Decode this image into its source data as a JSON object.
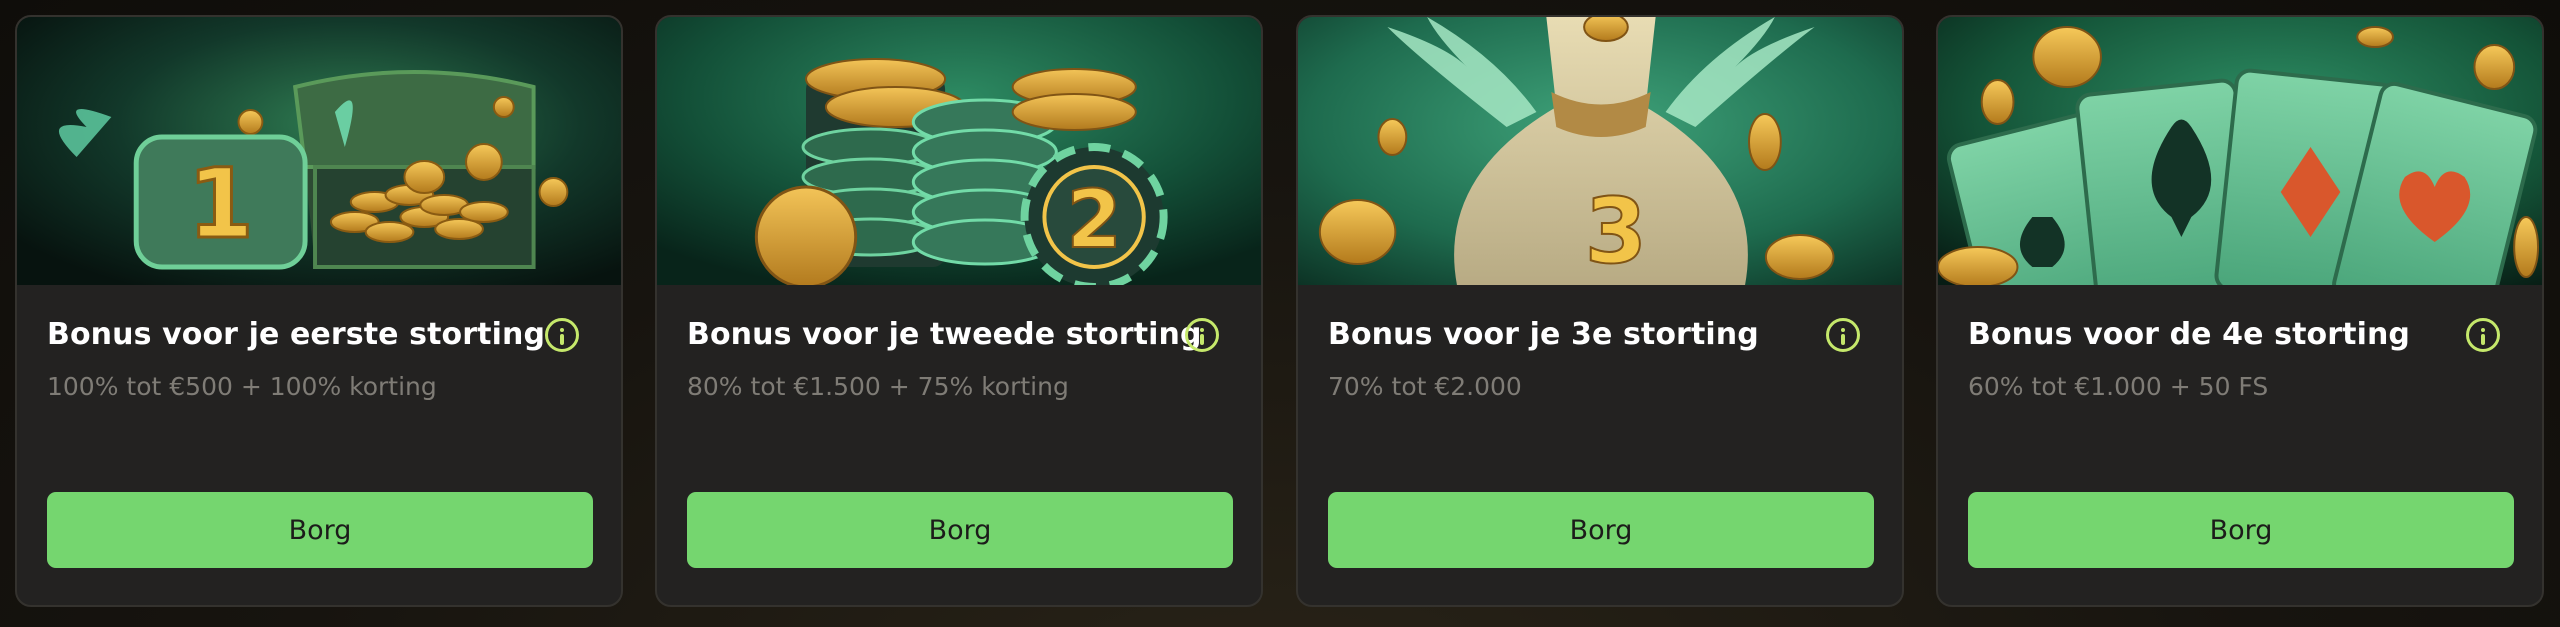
{
  "cards": [
    {
      "title": "Bonus voor je eerste storting",
      "subtitle": "100% tot €500 + 100% korting",
      "button_label": "Borg",
      "art_icon": "treasure-chest-icon",
      "art_numeral": "1"
    },
    {
      "title": "Bonus voor je tweede storting",
      "subtitle": "80% tot €1.500 + 75% korting",
      "button_label": "Borg",
      "art_icon": "casino-chips-icon",
      "art_numeral": "2"
    },
    {
      "title": "Bonus voor je 3e storting",
      "subtitle": "70% tot €2.000",
      "button_label": "Borg",
      "art_icon": "money-bag-icon",
      "art_numeral": "3"
    },
    {
      "title": "Bonus voor de 4e storting",
      "subtitle": "60% tot €1.000 + 50 FS",
      "button_label": "Borg",
      "art_icon": "playing-cards-icon",
      "art_numeral": ""
    }
  ],
  "colors": {
    "accent_button": "#75d66f",
    "info_icon": "#c5e86b",
    "card_background": "#232221",
    "subtitle_text": "#7f7c76"
  }
}
